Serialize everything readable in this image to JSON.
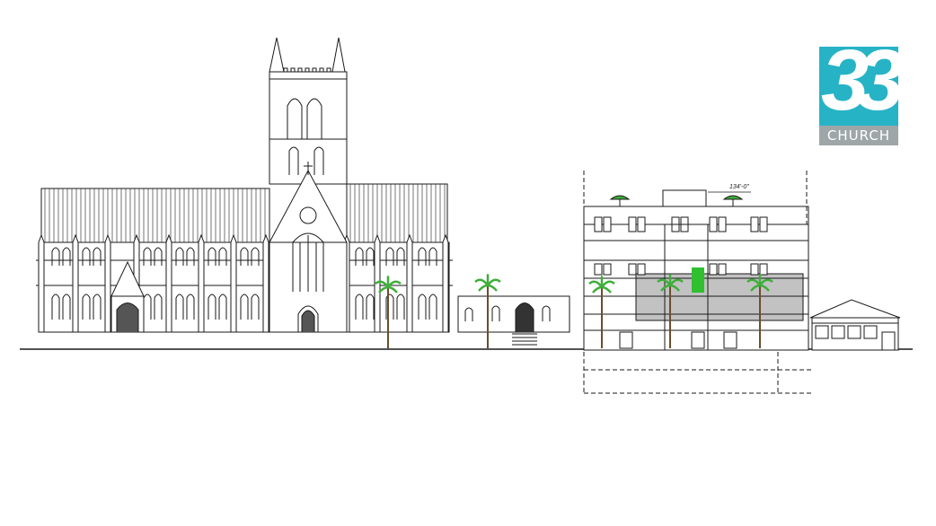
{
  "logo": {
    "number": "33",
    "word": "CHURCH",
    "accent": "#27b3c6",
    "band": "#9ea6a8"
  },
  "annotations": {
    "dimension": "134'-0\""
  },
  "colors": {
    "line": "#1a1a1a",
    "palm_leaf": "#3fae3a",
    "tinted_panel": "#c2c2c2",
    "accent_tree": "#2fbf2f"
  }
}
